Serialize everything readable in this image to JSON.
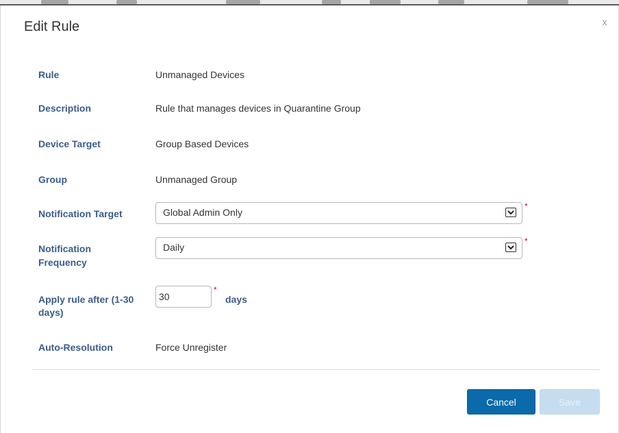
{
  "dialog": {
    "title": "Edit Rule",
    "close_label": "x"
  },
  "fields": {
    "rule": {
      "label": "Rule",
      "value": "Unmanaged Devices"
    },
    "description": {
      "label": "Description",
      "value": "Rule that manages devices in Quarantine Group"
    },
    "device_target": {
      "label": "Device Target",
      "value": "Group Based Devices"
    },
    "group": {
      "label": "Group",
      "value": "Unmanaged Group"
    },
    "notification_target": {
      "label": "Notification Target",
      "selected": "Global Admin Only",
      "required": true
    },
    "notification_frequency": {
      "label_line1": "Notification",
      "label_line2": "Frequency",
      "selected": "Daily",
      "required": true
    },
    "apply_rule_after": {
      "label_line1": "Apply rule after (1-30",
      "label_line2": "days)",
      "value": "30",
      "unit": "days",
      "required": true
    },
    "auto_resolution": {
      "label": "Auto-Resolution",
      "value": "Force Unregister"
    }
  },
  "required_marker": "*",
  "buttons": {
    "cancel": "Cancel",
    "save": "Save"
  },
  "icons": {
    "close": "close-icon",
    "dropdown": "chevron-down-icon"
  },
  "colors": {
    "label": "#3a5c8a",
    "primary_button": "#0a6aaa",
    "disabled_button": "#c6ddf0",
    "required": "#d0021b"
  }
}
